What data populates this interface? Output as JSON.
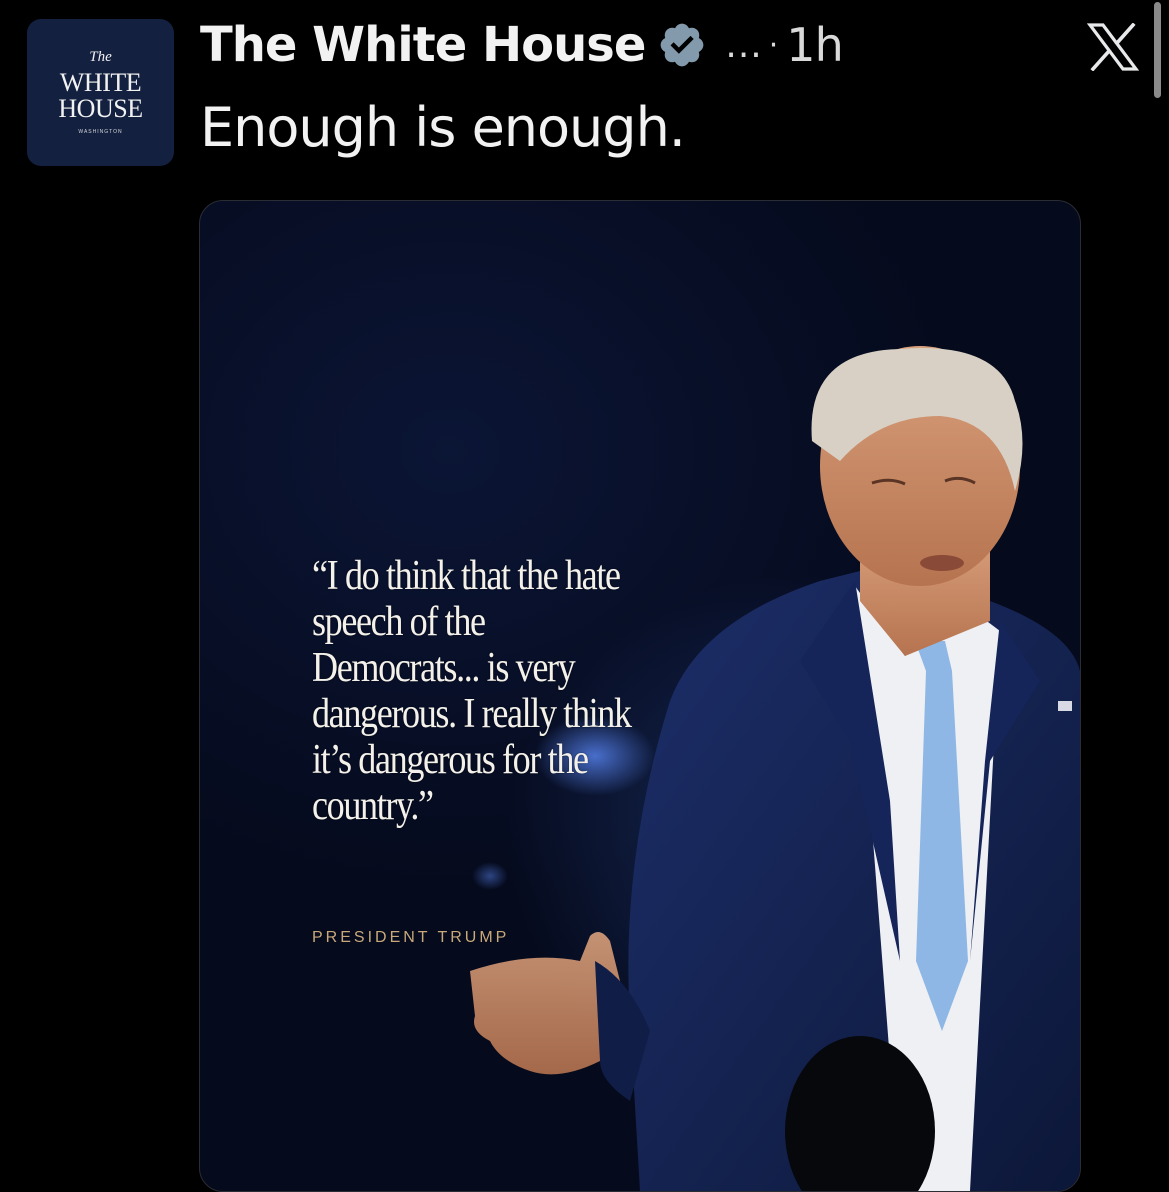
{
  "account": {
    "avatar": {
      "line1": "The",
      "line2": "WHITE",
      "line3": "HOUSE",
      "line4": "WASHINGTON"
    },
    "name": "The White House",
    "more": "...",
    "separator": "·",
    "timestamp": "1h"
  },
  "tweet": {
    "text": "Enough is enough."
  },
  "media": {
    "quote": "“I do think that the hate speech of the Democrats... is very dangerous. I really think it’s dangerous for the country.”",
    "attribution": "PRESIDENT TRUMP"
  },
  "icons": {
    "verified": "verified-badge-icon",
    "app_logo": "x-logo-icon"
  },
  "colors": {
    "background": "#000000",
    "text": "#e7e9ea",
    "verified_badge": "#829aab",
    "avatar_bg": "#13203f",
    "attribution": "#c9a97a"
  }
}
